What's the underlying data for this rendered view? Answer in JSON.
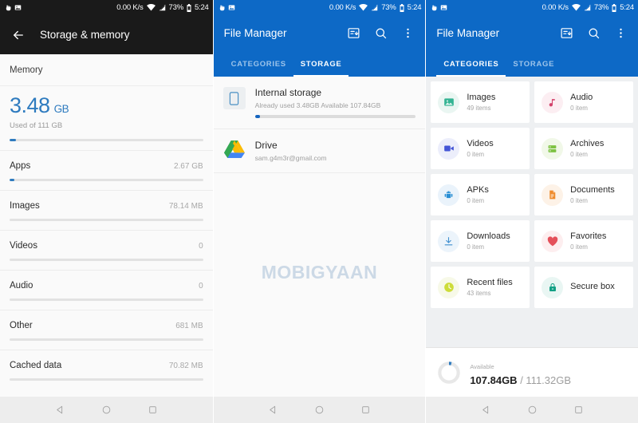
{
  "statusbar": {
    "speed": "0.00 K/s",
    "battery_percent": "73%",
    "clock": "5:24",
    "icons": [
      "touch-icon",
      "image-icon",
      "wifi-icon",
      "signal-icon",
      "battery-icon"
    ]
  },
  "panel1": {
    "title": "Storage & memory",
    "back_icon": "back-arrow-icon",
    "section_header": "Memory",
    "summary": {
      "value": "3.48",
      "unit": "GB",
      "subtitle": "Used of 111 GB",
      "bar_percent": 3.1
    },
    "rows": [
      {
        "label": "Apps",
        "value": "2.67 GB",
        "bar_percent": 2.4
      },
      {
        "label": "Images",
        "value": "78.14 MB",
        "bar_percent": 0
      },
      {
        "label": "Videos",
        "value": "0",
        "bar_percent": 0
      },
      {
        "label": "Audio",
        "value": "0",
        "bar_percent": 0
      },
      {
        "label": "Other",
        "value": "681 MB",
        "bar_percent": 0
      },
      {
        "label": "Cached data",
        "value": "70.82 MB",
        "bar_percent": 0
      }
    ]
  },
  "panel2": {
    "title": "File Manager",
    "toolbar_icons": [
      "transfer-icon",
      "search-icon",
      "overflow-menu-icon"
    ],
    "tabs": [
      {
        "label": "CATEGORIES",
        "active": false
      },
      {
        "label": "STORAGE",
        "active": true
      }
    ],
    "items": [
      {
        "icon": "phone-storage-icon",
        "title": "Internal storage",
        "subtitle": "Already used 3.48GB   Available 107.84GB",
        "bar_percent": 3.1
      },
      {
        "icon": "google-drive-icon",
        "title": "Drive",
        "subtitle": "sam.g4m3r@gmail.com"
      }
    ],
    "watermark": {
      "pre": "M",
      "o": "O",
      "post": "BIGYAAN"
    }
  },
  "panel3": {
    "title": "File Manager",
    "toolbar_icons": [
      "transfer-icon",
      "search-icon",
      "overflow-menu-icon"
    ],
    "tabs": [
      {
        "label": "CATEGORIES",
        "active": true
      },
      {
        "label": "STORAGE",
        "active": false
      }
    ],
    "categories": [
      {
        "label": "Images",
        "count": "49 items",
        "icon": "image-icon",
        "color": "#34b493",
        "bg": "#eaf6f2"
      },
      {
        "label": "Audio",
        "count": "0 item",
        "icon": "music-note-icon",
        "color": "#d3426b",
        "bg": "#fceef2"
      },
      {
        "label": "Videos",
        "count": "0 item",
        "icon": "video-icon",
        "color": "#4455d6",
        "bg": "#eceefb"
      },
      {
        "label": "Archives",
        "count": "0 item",
        "icon": "archive-icon",
        "color": "#7dc242",
        "bg": "#f1f8e8"
      },
      {
        "label": "APKs",
        "count": "0 item",
        "icon": "android-icon",
        "color": "#2a8fd4",
        "bg": "#eaf3fb"
      },
      {
        "label": "Documents",
        "count": "0 item",
        "icon": "document-icon",
        "color": "#ef8b2c",
        "bg": "#fdf2e7"
      },
      {
        "label": "Downloads",
        "count": "0 item",
        "icon": "download-icon",
        "color": "#3f8fd0",
        "bg": "#ecf4fb"
      },
      {
        "label": "Favorites",
        "count": "0 item",
        "icon": "heart-icon",
        "color": "#e4505a",
        "bg": "#fdeeef"
      },
      {
        "label": "Recent files",
        "count": "43 items",
        "icon": "clock-icon",
        "color": "#cddc39",
        "bg": "#f7f9e8"
      },
      {
        "label": "Secure box",
        "count": "",
        "icon": "lock-icon",
        "color": "#13a085",
        "bg": "#e9f6f3"
      }
    ],
    "footer": {
      "label": "Available",
      "used_value": "107.84GB",
      "separator": " / ",
      "total_value": "111.32GB",
      "donut_percent": 4
    }
  },
  "navbar": {
    "back": "back-triangle-icon",
    "home": "home-circle-icon",
    "recents": "recents-square-icon"
  },
  "colors": {
    "accent_blue": "#0d69c6",
    "bar_blue": "#2e7bbf",
    "dark_bar": "#1a1a1a"
  }
}
